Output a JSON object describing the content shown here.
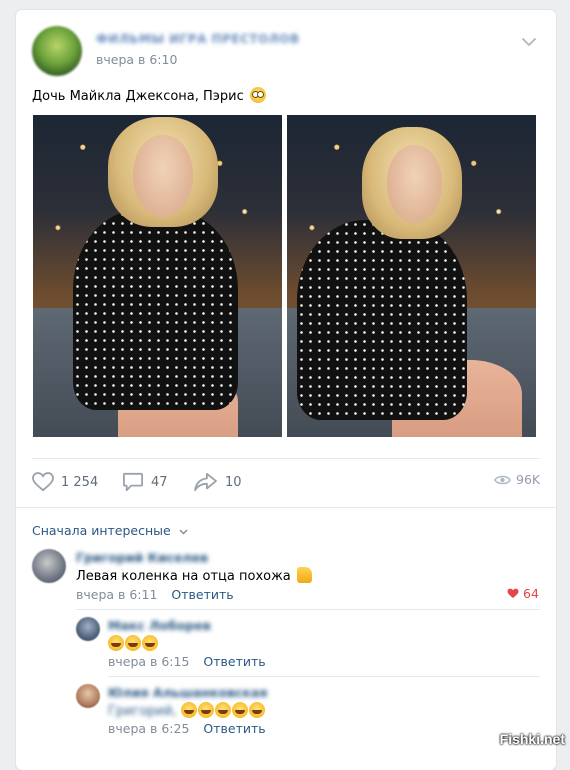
{
  "post": {
    "group_name": "ФИЛЬМЫ ИГРА ПРЕСТОЛОВ",
    "time": "вчера в 6:10",
    "text": "Дочь Майкла Джексона, Пэрис",
    "text_emoji": "eye-roll-emoji",
    "photos": [
      "photo-1",
      "photo-2"
    ]
  },
  "actions": {
    "likes": "1 254",
    "comments": "47",
    "shares": "10",
    "views": "96K"
  },
  "comments_section": {
    "sort_label": "Сначала интересные",
    "comments": [
      {
        "author": "Григорий Киселев",
        "text": "Левая коленка на отца похожа",
        "emoji": "thumbs-up-emoji",
        "time": "вчера в 6:11",
        "reply": "Ответить",
        "likes": "64"
      },
      {
        "author": "Макс Лоборев",
        "text": "",
        "emoji": "rolling-laughing-emoji x3",
        "time": "вчера в 6:15",
        "reply": "Ответить"
      },
      {
        "author": "Юлия Альшанковская",
        "text_prefix": "Григорий,",
        "emoji": "rolling-laughing-emoji x5",
        "time": "вчера в 6:25",
        "reply": "Ответить"
      }
    ]
  },
  "watermark": "Fishki.net",
  "colors": {
    "link": "#2a5885",
    "meta": "#818c99",
    "like_red": "#e64646",
    "page_bg": "#edeef0"
  }
}
